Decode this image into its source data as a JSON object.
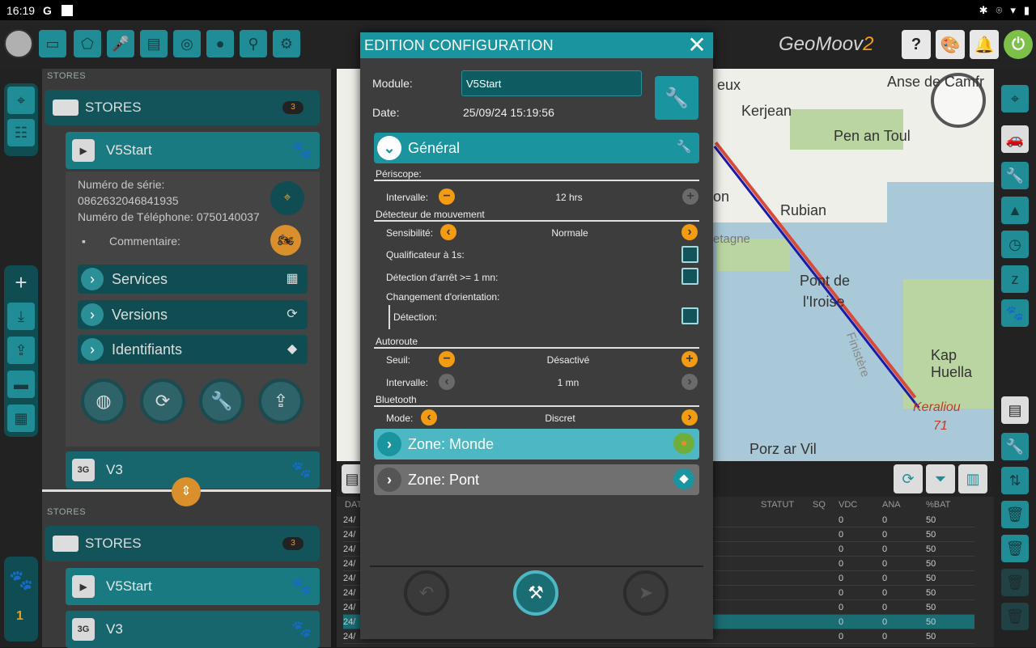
{
  "statusbar": {
    "time": "16:19",
    "app_initial": "G"
  },
  "topbar": {
    "brand": "GeoMoov",
    "brand_suffix": "2",
    "help": "?"
  },
  "stores_panel": {
    "section_label": "STORES",
    "store_title": "STORES",
    "store_count": "3",
    "device_name": "V5Start",
    "serial_label": "Numéro de série:",
    "serial_value": "0862632046841935",
    "phone_label": "Numéro de Téléphone:",
    "phone_value": "0750140037",
    "comment_label": "Commentaire:",
    "menu": [
      {
        "label": "Services",
        "icon": "calendar-icon"
      },
      {
        "label": "Versions",
        "icon": "refresh-icon"
      },
      {
        "label": "Identifiants",
        "icon": "tag-icon"
      }
    ],
    "device2_name": "V3",
    "device2_badge": "3G",
    "lower_section_label": "STORES",
    "lower_store_title": "STORES",
    "lower_store_count": "3",
    "lower_device1": "V5Start",
    "lower_device2": "V3",
    "lower_device2_badge": "3G"
  },
  "left_rail": {
    "counter": "1"
  },
  "map": {
    "labels": {
      "a": "Anse de Camfr",
      "b": "Kerjean",
      "c": "Pen an Toul",
      "d": "Rubian",
      "e": "Pont de",
      "f": "l'Iroise",
      "g": "Kap Huella",
      "h": "Porz ar Vil",
      "i": "Keraliou",
      "j": "71",
      "k": "Finistère",
      "l": "etagne",
      "m": "eux",
      "n": "on"
    }
  },
  "table": {
    "headers": {
      "col0": "DAT",
      "statut": "STATUT",
      "sq": "SQ",
      "vdc": "VDC",
      "ana": "ANA",
      "bat": "%BAT"
    },
    "rows": [
      {
        "date": "24/",
        "vdc": "0",
        "ana": "0",
        "bat": "50"
      },
      {
        "date": "24/",
        "vdc": "0",
        "ana": "0",
        "bat": "50"
      },
      {
        "date": "24/",
        "vdc": "0",
        "ana": "0",
        "bat": "50"
      },
      {
        "date": "24/",
        "vdc": "0",
        "ana": "0",
        "bat": "50"
      },
      {
        "date": "24/",
        "vdc": "0",
        "ana": "0",
        "bat": "50"
      },
      {
        "date": "24/",
        "vdc": "0",
        "ana": "0",
        "bat": "50"
      },
      {
        "date": "24/",
        "vdc": "0",
        "ana": "0",
        "bat": "50"
      },
      {
        "date": "24/",
        "vdc": "0",
        "ana": "0",
        "bat": "50"
      },
      {
        "date": "24/",
        "vdc": "0",
        "ana": "0",
        "bat": "50"
      }
    ]
  },
  "modal": {
    "title": "EDITION CONFIGURATION",
    "module_label": "Module:",
    "module_value": "V5Start",
    "date_label": "Date:",
    "date_value": "25/09/24 15:19:56",
    "general": "Général",
    "periscope": {
      "title": "Périscope:",
      "interval_label": "Intervalle:",
      "interval_value": "12 hrs"
    },
    "motion": {
      "title": "Détecteur de mouvement",
      "sensitivity_label": "Sensibilité:",
      "sensitivity_value": "Normale",
      "qualifier_label": "Qualificateur à 1s:",
      "stop_label": "Détection d'arrêt >= 1 mn:",
      "orientation_label": "Changement d'orientation:",
      "detection_label": "Détection:"
    },
    "highway": {
      "title": "Autoroute",
      "threshold_label": "Seuil:",
      "threshold_value": "Désactivé",
      "interval_label": "Intervalle:",
      "interval_value": "1 mn"
    },
    "bluetooth": {
      "title": "Bluetooth",
      "mode_label": "Mode:",
      "mode_value": "Discret"
    },
    "zone_world": "Zone: Monde",
    "zone_bridge": "Zone: Pont"
  }
}
